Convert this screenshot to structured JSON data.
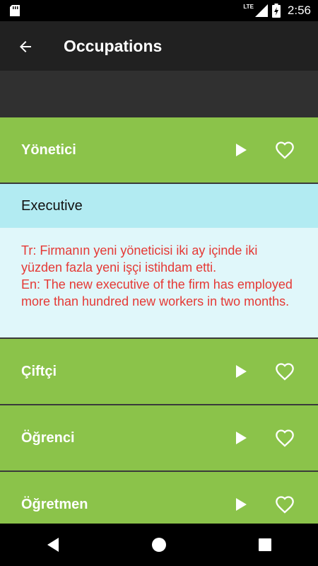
{
  "status_bar": {
    "network": "LTE",
    "time": "2:56"
  },
  "app_bar": {
    "title": "Occupations"
  },
  "items": [
    {
      "label": "Yönetici"
    },
    {
      "label": "Çiftçi"
    },
    {
      "label": "Öğrenci"
    },
    {
      "label": "Öğretmen"
    }
  ],
  "expanded": {
    "translation": "Executive",
    "example_tr": "Tr: Firmanın yeni yöneticisi iki ay içinde iki yüzden fazla yeni işçi istihdam etti.",
    "example_en": "En: The new executive of the firm has employed more than hundred new workers in two months."
  },
  "colors": {
    "item_bg": "#8bc34a",
    "translation_bg": "#b2ebf2",
    "example_bg": "#e0f7fa",
    "example_text": "#e53935"
  },
  "icons": [
    "back-arrow-icon",
    "play-icon",
    "heart-outline-icon",
    "nav-back-icon",
    "nav-home-icon",
    "nav-recents-icon",
    "sd-card-icon",
    "signal-icon",
    "battery-icon"
  ]
}
